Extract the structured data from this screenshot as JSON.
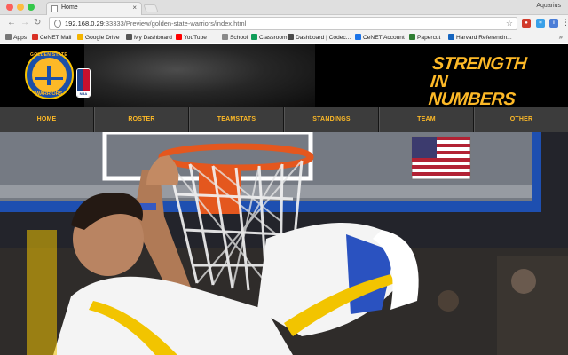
{
  "browser": {
    "tab_title": "Home",
    "profile_name": "Aquarius",
    "url_host": "192.168.0.29",
    "url_path": ":33333/Preview/golden-state-warriors/index.html",
    "bookmarks": [
      {
        "label": "Apps",
        "color": "#777777"
      },
      {
        "label": "CeNET Mail",
        "color": "#d93025"
      },
      {
        "label": "Google Drive",
        "color": "#f4b400"
      },
      {
        "label": "My Dashboard",
        "color": "#555555"
      },
      {
        "label": "YouTube",
        "color": "#ff0000"
      },
      {
        "label": "School",
        "color": "#8a8a8a"
      },
      {
        "label": "Classroom",
        "color": "#0f9d58"
      },
      {
        "label": "Dashboard | Codec...",
        "color": "#4a4a4a"
      },
      {
        "label": "CeNET Account",
        "color": "#1a73e8"
      },
      {
        "label": "Papercut",
        "color": "#2e7d32"
      },
      {
        "label": "Harvard Referencin...",
        "color": "#1565c0"
      }
    ],
    "bookmarks_more": "»"
  },
  "site": {
    "slogan_line1": "STRENGTH",
    "slogan_line2": "IN NUMBERS",
    "logo_text_top": "GOLDEN STATE",
    "logo_text_bottom": "WARRIORS",
    "nba_text": "NBA",
    "accent_color": "#fdb927",
    "nav": [
      "HOME",
      "ROSTER",
      "TEAMSTATS",
      "STANDINGS",
      "TEAM",
      "OTHER"
    ]
  }
}
